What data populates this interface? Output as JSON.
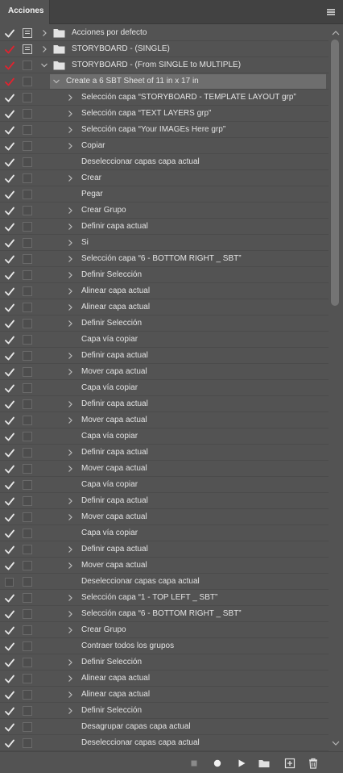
{
  "panel": {
    "tab_label": "Acciones",
    "menu_icon": "panel-menu-icon"
  },
  "colors": {
    "check_white": "#e8e8e8",
    "check_red": "#e0232f",
    "selected_row": "#6e6e6e"
  },
  "rows": [
    {
      "check": "white",
      "dialog": "on",
      "level": 0,
      "twisty": "right",
      "folder": true,
      "label": "Acciones por defecto"
    },
    {
      "check": "red",
      "dialog": "on",
      "level": 0,
      "twisty": "right",
      "folder": true,
      "label": "STORYBOARD - (SINGLE)"
    },
    {
      "check": "red",
      "dialog": "off",
      "level": 0,
      "twisty": "down",
      "folder": true,
      "label": "STORYBOARD - (From SINGLE to MULTIPLE)"
    },
    {
      "check": "red",
      "dialog": "off",
      "level": 1,
      "twisty": "down",
      "folder": false,
      "selected": true,
      "label": "Create a 6 SBT Sheet of 11 in x 17 in"
    },
    {
      "check": "white",
      "dialog": "off",
      "level": 2,
      "twisty": "right",
      "label": "Selección capa “STORYBOARD - TEMPLATE LAYOUT grp”"
    },
    {
      "check": "white",
      "dialog": "off",
      "level": 2,
      "twisty": "right",
      "label": "Selección capa “TEXT LAYERS grp”"
    },
    {
      "check": "white",
      "dialog": "off",
      "level": 2,
      "twisty": "right",
      "label": "Selección capa “Your IMAGEs Here grp”"
    },
    {
      "check": "white",
      "dialog": "off",
      "level": 2,
      "twisty": "right",
      "label": "Copiar"
    },
    {
      "check": "white",
      "dialog": "off",
      "level": 2,
      "twisty": "none",
      "label": "Deseleccionar capas capa actual"
    },
    {
      "check": "white",
      "dialog": "off",
      "level": 2,
      "twisty": "right",
      "label": "Crear"
    },
    {
      "check": "white",
      "dialog": "off",
      "level": 2,
      "twisty": "none",
      "label": "Pegar"
    },
    {
      "check": "white",
      "dialog": "off",
      "level": 2,
      "twisty": "right",
      "label": "Crear Grupo"
    },
    {
      "check": "white",
      "dialog": "off",
      "level": 2,
      "twisty": "right",
      "label": "Definir capa actual"
    },
    {
      "check": "white",
      "dialog": "off",
      "level": 2,
      "twisty": "right",
      "label": "Si"
    },
    {
      "check": "white",
      "dialog": "off",
      "level": 2,
      "twisty": "right",
      "label": "Selección capa “6 - BOTTOM RIGHT _ SBT”"
    },
    {
      "check": "white",
      "dialog": "off",
      "level": 2,
      "twisty": "right",
      "label": "Definir Selección"
    },
    {
      "check": "white",
      "dialog": "off",
      "level": 2,
      "twisty": "right",
      "label": "Alinear capa actual"
    },
    {
      "check": "white",
      "dialog": "off",
      "level": 2,
      "twisty": "right",
      "label": "Alinear capa actual"
    },
    {
      "check": "white",
      "dialog": "off",
      "level": 2,
      "twisty": "right",
      "label": "Definir Selección"
    },
    {
      "check": "white",
      "dialog": "off",
      "level": 2,
      "twisty": "none",
      "label": "Capa vía copiar"
    },
    {
      "check": "white",
      "dialog": "off",
      "level": 2,
      "twisty": "right",
      "label": "Definir capa actual"
    },
    {
      "check": "white",
      "dialog": "off",
      "level": 2,
      "twisty": "right",
      "label": "Mover capa actual"
    },
    {
      "check": "white",
      "dialog": "off",
      "level": 2,
      "twisty": "none",
      "label": "Capa vía copiar"
    },
    {
      "check": "white",
      "dialog": "off",
      "level": 2,
      "twisty": "right",
      "label": "Definir capa actual"
    },
    {
      "check": "white",
      "dialog": "off",
      "level": 2,
      "twisty": "right",
      "label": "Mover capa actual"
    },
    {
      "check": "white",
      "dialog": "off",
      "level": 2,
      "twisty": "none",
      "label": "Capa vía copiar"
    },
    {
      "check": "white",
      "dialog": "off",
      "level": 2,
      "twisty": "right",
      "label": "Definir capa actual"
    },
    {
      "check": "white",
      "dialog": "off",
      "level": 2,
      "twisty": "right",
      "label": "Mover capa actual"
    },
    {
      "check": "white",
      "dialog": "off",
      "level": 2,
      "twisty": "none",
      "label": "Capa vía copiar"
    },
    {
      "check": "white",
      "dialog": "off",
      "level": 2,
      "twisty": "right",
      "label": "Definir capa actual"
    },
    {
      "check": "white",
      "dialog": "off",
      "level": 2,
      "twisty": "right",
      "label": "Mover capa actual"
    },
    {
      "check": "white",
      "dialog": "off",
      "level": 2,
      "twisty": "none",
      "label": "Capa vía copiar"
    },
    {
      "check": "white",
      "dialog": "off",
      "level": 2,
      "twisty": "right",
      "label": "Definir capa actual"
    },
    {
      "check": "white",
      "dialog": "off",
      "level": 2,
      "twisty": "right",
      "label": "Mover capa actual"
    },
    {
      "check": "empty",
      "dialog": "off",
      "level": 2,
      "twisty": "none",
      "label": "Deseleccionar capas capa actual"
    },
    {
      "check": "white",
      "dialog": "off",
      "level": 2,
      "twisty": "right",
      "label": "Selección capa “1 - TOP LEFT _ SBT”"
    },
    {
      "check": "white",
      "dialog": "off",
      "level": 2,
      "twisty": "right",
      "label": "Selección capa “6 - BOTTOM RIGHT _ SBT”"
    },
    {
      "check": "white",
      "dialog": "off",
      "level": 2,
      "twisty": "right",
      "label": "Crear Grupo"
    },
    {
      "check": "white",
      "dialog": "off",
      "level": 2,
      "twisty": "none",
      "label": "Contraer todos los grupos"
    },
    {
      "check": "white",
      "dialog": "off",
      "level": 2,
      "twisty": "right",
      "label": "Definir Selección"
    },
    {
      "check": "white",
      "dialog": "off",
      "level": 2,
      "twisty": "right",
      "label": "Alinear capa actual"
    },
    {
      "check": "white",
      "dialog": "off",
      "level": 2,
      "twisty": "right",
      "label": "Alinear capa actual"
    },
    {
      "check": "white",
      "dialog": "off",
      "level": 2,
      "twisty": "right",
      "label": "Definir Selección"
    },
    {
      "check": "white",
      "dialog": "off",
      "level": 2,
      "twisty": "none",
      "label": "Desagrupar capas capa actual"
    },
    {
      "check": "white",
      "dialog": "off",
      "level": 2,
      "twisty": "none",
      "label": "Deseleccionar capas capa actual"
    }
  ],
  "toolbar": {
    "buttons": [
      {
        "name": "stop-button",
        "icon": "stop-icon"
      },
      {
        "name": "record-button",
        "icon": "record-icon"
      },
      {
        "name": "play-button",
        "icon": "play-icon"
      },
      {
        "name": "new-set-button",
        "icon": "folder-icon"
      },
      {
        "name": "new-action-button",
        "icon": "new-item-icon"
      },
      {
        "name": "delete-button",
        "icon": "trash-icon"
      }
    ]
  }
}
